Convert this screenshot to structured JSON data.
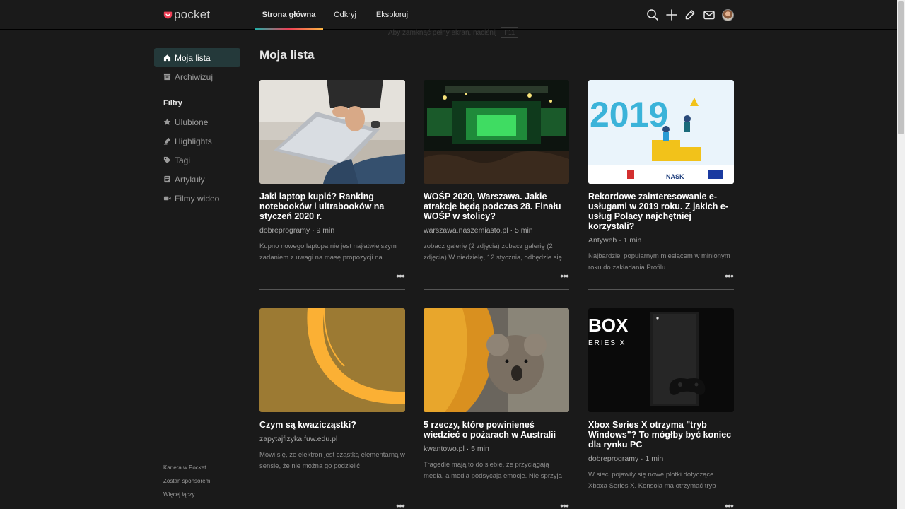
{
  "header": {
    "logo_text": "pocket",
    "tabs": [
      {
        "label": "Strona główna",
        "active": true
      },
      {
        "label": "Odkryj",
        "active": false
      },
      {
        "label": "Eksploruj",
        "active": false
      }
    ],
    "icons": [
      "search-icon",
      "add-icon",
      "highlighter-icon",
      "inbox-icon"
    ],
    "fullscreen_hint": "Aby zamknąć pełny ekran, naciśnij",
    "fullscreen_key": "F11"
  },
  "sidebar": {
    "items": [
      {
        "label": "Moja lista",
        "icon": "home-icon",
        "active": true
      },
      {
        "label": "Archiwizuj",
        "icon": "archive-icon",
        "active": false
      }
    ],
    "filters_heading": "Filtry",
    "filters": [
      {
        "label": "Ulubione",
        "icon": "star-icon"
      },
      {
        "label": "Highlights",
        "icon": "highlight-icon"
      },
      {
        "label": "Tagi",
        "icon": "tag-icon"
      },
      {
        "label": "Artykuły",
        "icon": "article-icon"
      },
      {
        "label": "Filmy wideo",
        "icon": "video-icon"
      }
    ],
    "footer_links": [
      "Kariera w Pocket",
      "Zostań sponsorem",
      "Więcej łączy"
    ]
  },
  "main": {
    "title": "Moja lista",
    "cards": [
      {
        "title": "Jaki laptop kupić? Ranking notebooków i ultrabooków na styczeń 2020 r.",
        "meta": "dobreprogramy · 9 min",
        "excerpt": "Kupno nowego laptopa nie jest najłatwiejszym zadaniem z uwagi na masę propozycji na"
      },
      {
        "title": "WOŚP 2020, Warszawa. Jakie atrakcje będą podczas 28. Finału WOŚP w stolicy?",
        "meta": "warszawa.naszemiasto.pl · 5 min",
        "excerpt": "zobacz galerię (2 zdjęcia) zobacz galerię (2 zdjęcia) W niedzielę, 12 stycznia, odbędzie się"
      },
      {
        "title": "Rekordowe zainteresowanie e-usługami w 2019 roku. Z jakich e-usług Polacy najchętniej korzystali?",
        "meta": "Antyweb · 1 min",
        "excerpt": "Najbardziej popularnym miesiącem w minionym roku do zakładania Profilu",
        "image_text": "2019",
        "image_caption": "NASK"
      },
      {
        "title": "Czym są kwazicząstki?",
        "meta": "zapytajfizyka.fuw.edu.pl",
        "excerpt": "Mówi się, że elektron jest cząstką elementarną w sensie, że nie można go podzielić"
      },
      {
        "title": "5 rzeczy, które powinieneś wiedzieć o pożarach w Australii",
        "meta": "kwantowo.pl · 5 min",
        "excerpt": "Tragedie mają to do siebie, że przyciągają media, a media podsycają emocje. Nie sprzyja"
      },
      {
        "title": "Xbox Series X otrzyma \"tryb Windows\"? To mógłby być koniec dla rynku PC",
        "meta": "dobreprogramy · 1 min",
        "excerpt": "W sieci pojawiły się nowe plotki dotyczące Xboxa Series X. Konsola ma otrzymać tryb",
        "image_text": "BOX",
        "image_sub": "ERIES X"
      }
    ]
  },
  "colors": {
    "background": "#1a1a1a",
    "active_sidebar": "#24393a",
    "accent_gradient": [
      "#1cb0a8",
      "#ef4056",
      "#fcb643"
    ],
    "logo_red": "#ef4056"
  }
}
